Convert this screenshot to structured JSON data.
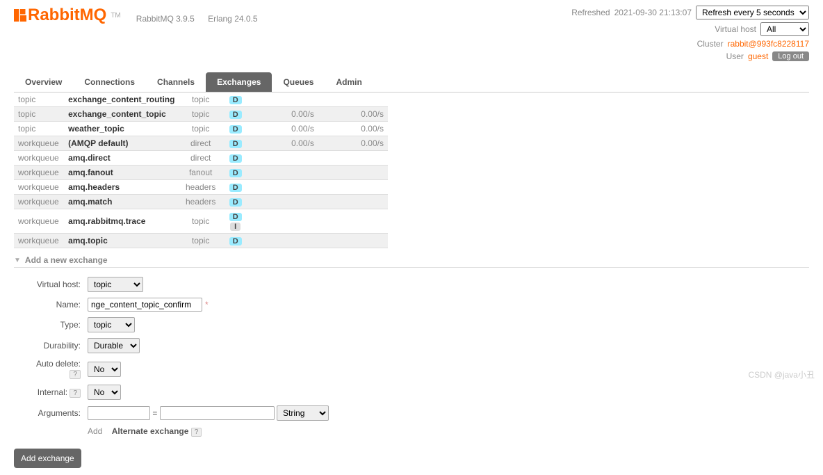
{
  "logo": {
    "text": "RabbitMQ",
    "tm": "TM"
  },
  "versions": {
    "product": "RabbitMQ 3.9.5",
    "erlang": "Erlang 24.0.5"
  },
  "header": {
    "refreshed_label": "Refreshed",
    "refreshed_time": "2021-09-30 21:13:07",
    "refresh_select": "Refresh every 5 seconds",
    "vhost_label": "Virtual host",
    "vhost_select": "All",
    "cluster_label": "Cluster",
    "cluster_value": "rabbit@993fc8228117",
    "user_label": "User",
    "user_value": "guest",
    "logout": "Log out"
  },
  "tabs": [
    "Overview",
    "Connections",
    "Channels",
    "Exchanges",
    "Queues",
    "Admin"
  ],
  "active_tab": 3,
  "exchanges": [
    {
      "vhost": "topic",
      "name": "exchange_content_routing",
      "type": "topic",
      "d": true,
      "i": false,
      "in": "",
      "out": ""
    },
    {
      "vhost": "topic",
      "name": "exchange_content_topic",
      "type": "topic",
      "d": true,
      "i": false,
      "in": "0.00/s",
      "out": "0.00/s"
    },
    {
      "vhost": "topic",
      "name": "weather_topic",
      "type": "topic",
      "d": true,
      "i": false,
      "in": "0.00/s",
      "out": "0.00/s"
    },
    {
      "vhost": "workqueue",
      "name": "(AMQP default)",
      "type": "direct",
      "d": true,
      "i": false,
      "in": "0.00/s",
      "out": "0.00/s"
    },
    {
      "vhost": "workqueue",
      "name": "amq.direct",
      "type": "direct",
      "d": true,
      "i": false,
      "in": "",
      "out": ""
    },
    {
      "vhost": "workqueue",
      "name": "amq.fanout",
      "type": "fanout",
      "d": true,
      "i": false,
      "in": "",
      "out": ""
    },
    {
      "vhost": "workqueue",
      "name": "amq.headers",
      "type": "headers",
      "d": true,
      "i": false,
      "in": "",
      "out": ""
    },
    {
      "vhost": "workqueue",
      "name": "amq.match",
      "type": "headers",
      "d": true,
      "i": false,
      "in": "",
      "out": ""
    },
    {
      "vhost": "workqueue",
      "name": "amq.rabbitmq.trace",
      "type": "topic",
      "d": true,
      "i": true,
      "in": "",
      "out": ""
    },
    {
      "vhost": "workqueue",
      "name": "amq.topic",
      "type": "topic",
      "d": true,
      "i": false,
      "in": "",
      "out": ""
    }
  ],
  "tags": {
    "d": "D",
    "i": "I"
  },
  "section_title": "Add a new exchange",
  "form": {
    "vhost_label": "Virtual host:",
    "vhost_value": "topic",
    "name_label": "Name:",
    "name_value": "nge_content_topic_confirm",
    "type_label": "Type:",
    "type_value": "topic",
    "durability_label": "Durability:",
    "durability_value": "Durable",
    "autodelete_label": "Auto delete:",
    "autodelete_value": "No",
    "internal_label": "Internal:",
    "internal_value": "No",
    "arguments_label": "Arguments:",
    "arg_type_value": "String",
    "add_label": "Add",
    "alt_exch_label": "Alternate exchange",
    "help": "?",
    "mand": "*",
    "equals": "="
  },
  "add_button": "Add exchange",
  "watermark": "CSDN @java小丑"
}
